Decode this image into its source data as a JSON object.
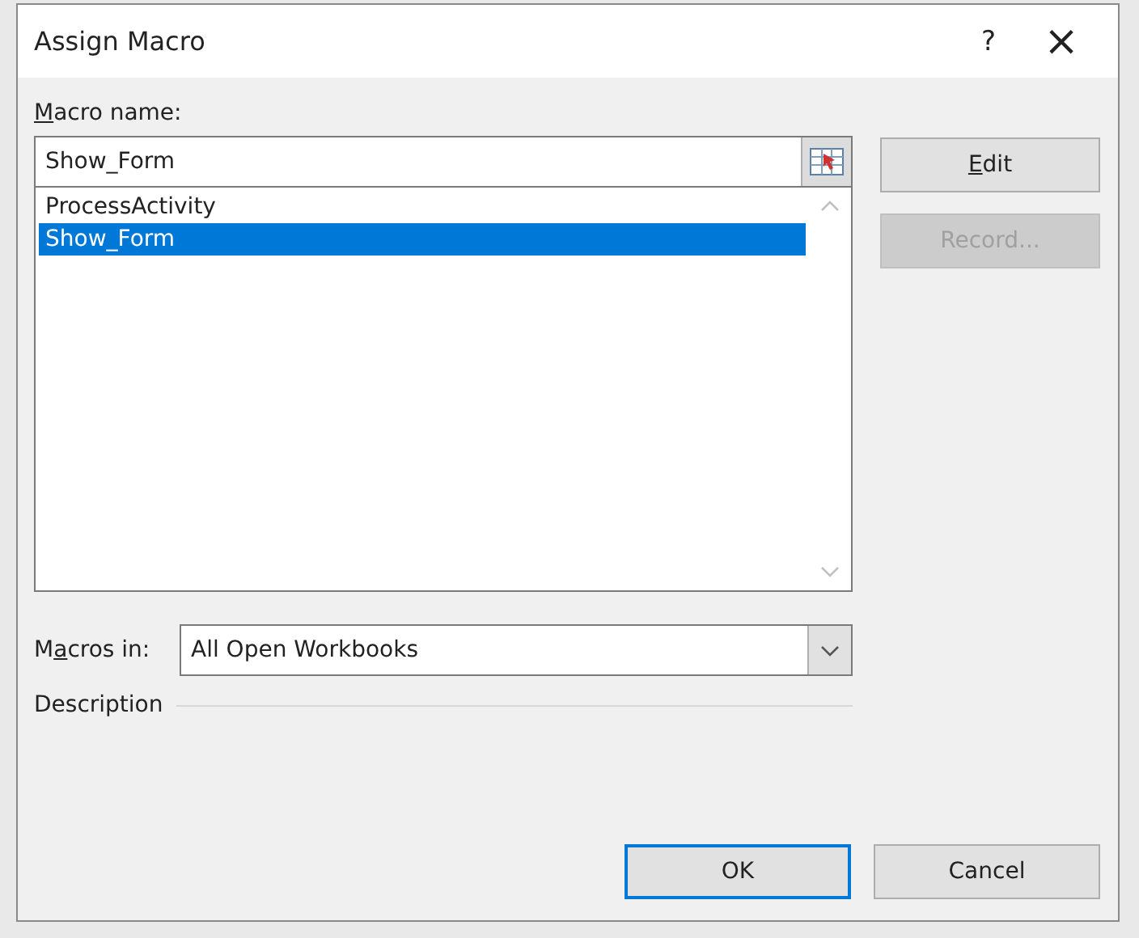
{
  "window": {
    "title": "Assign Macro",
    "help": "?",
    "close": "×"
  },
  "macro_name": {
    "label": {
      "key": "M",
      "after": "acro name:"
    },
    "value": "Show_Form"
  },
  "macros": [
    {
      "name": "ProcessActivity",
      "selected": false
    },
    {
      "name": "Show_Form",
      "selected": true
    }
  ],
  "side_buttons": [
    {
      "label": {
        "key": "E",
        "after": "dit"
      },
      "disabled": false
    },
    {
      "label": {
        "before": "Record..."
      },
      "disabled": true
    }
  ],
  "macros_in": {
    "label": {
      "before": "M",
      "key": "a",
      "after": "cros in:"
    },
    "value": "All Open Workbooks"
  },
  "description": {
    "label": "Description"
  },
  "buttons": [
    {
      "label": "OK",
      "focused": true
    },
    {
      "label": "Cancel",
      "focused": false
    }
  ]
}
